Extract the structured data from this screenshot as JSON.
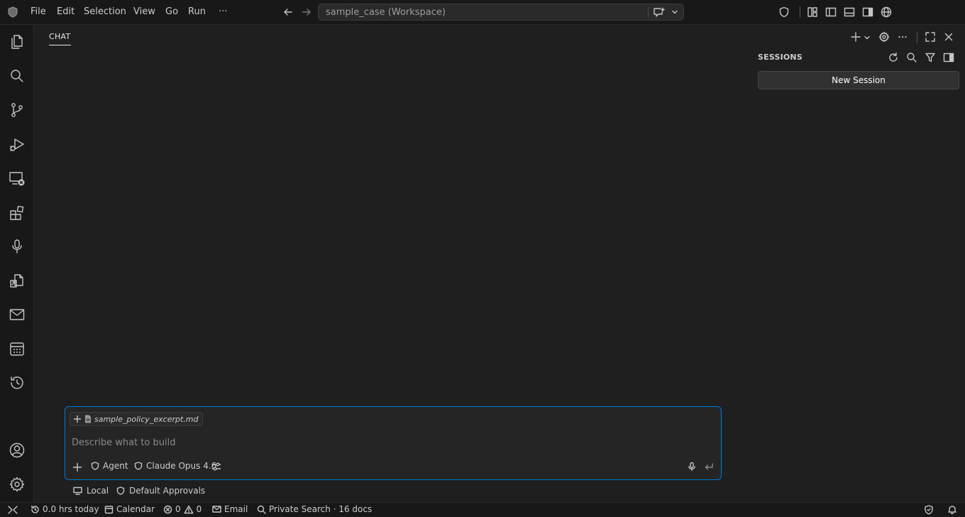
{
  "menu": {
    "items": [
      "File",
      "Edit",
      "Selection",
      "View",
      "Go",
      "Run"
    ],
    "more": "···"
  },
  "command_center": {
    "text": "sample_case (Workspace)"
  },
  "chat": {
    "title": "CHAT",
    "attachment": "sample_policy_excerpt.md",
    "placeholder": "Describe what to build",
    "mode_label": "Agent",
    "model_label": "Claude Opus 4.6",
    "location_label": "Local",
    "approvals_label": "Default Approvals"
  },
  "sessions": {
    "title": "SESSIONS",
    "new_button": "New Session"
  },
  "status": {
    "time_today": "0.0 hrs today",
    "calendar": "Calendar",
    "errors": "0",
    "warnings": "0",
    "email": "Email",
    "search": "Private Search · 16 docs"
  },
  "colors": {
    "background": "#1f1f1f",
    "chrome": "#181818",
    "accent": "#0078d4"
  }
}
